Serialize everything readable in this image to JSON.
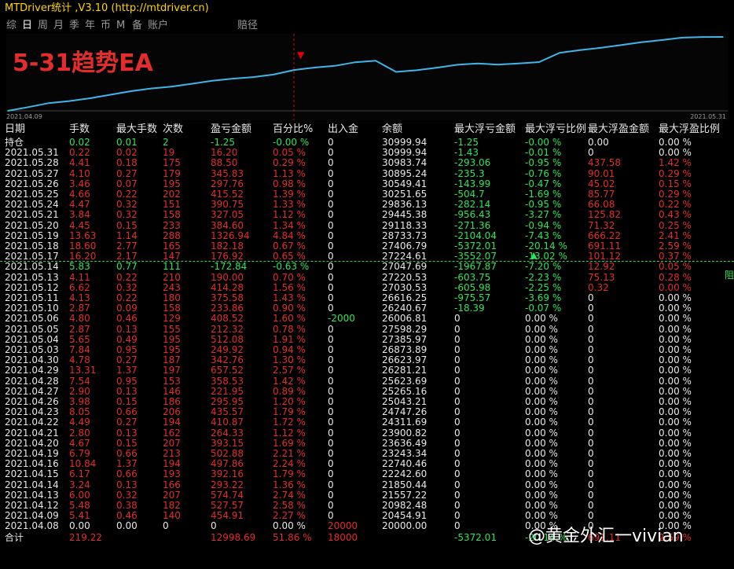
{
  "app": {
    "title": "MTDriver统计 ,V3.10 (http://mtdriver.cn)"
  },
  "tabs": [
    {
      "label": "综"
    },
    {
      "label": "日"
    },
    {
      "label": "周"
    },
    {
      "label": "月"
    },
    {
      "label": "季"
    },
    {
      "label": "年"
    },
    {
      "label": "币"
    },
    {
      "label": "M"
    },
    {
      "label": "备"
    },
    {
      "label": "账户"
    },
    {
      "label": "赔径"
    }
  ],
  "active_tab": 1,
  "chart": {
    "label": "5-31趋势EA",
    "start_date": "2021.04.09",
    "end_date": "2021.05.31",
    "line_color": "#3fb6e8",
    "chart_data": {
      "type": "line",
      "x": [
        "2021.04.09",
        "2021.04.12",
        "2021.04.13",
        "2021.04.14",
        "2021.04.15",
        "2021.04.16",
        "2021.04.19",
        "2021.04.20",
        "2021.04.21",
        "2021.04.22",
        "2021.04.23",
        "2021.04.26",
        "2021.04.27",
        "2021.04.28",
        "2021.04.29",
        "2021.04.30",
        "2021.05.03",
        "2021.05.04",
        "2021.05.05",
        "2021.05.06",
        "2021.05.10",
        "2021.05.11",
        "2021.05.12",
        "2021.05.13",
        "2021.05.14",
        "2021.05.17",
        "2021.05.18",
        "2021.05.19",
        "2021.05.20",
        "2021.05.21",
        "2021.05.24",
        "2021.05.25",
        "2021.05.26",
        "2021.05.27",
        "2021.05.28",
        "2021.05.31"
      ],
      "y": [
        20454.91,
        20982.48,
        21557.22,
        21850.44,
        22242.6,
        22740.46,
        23243.34,
        23636.49,
        23900.82,
        24311.69,
        24747.26,
        25043.21,
        25265.16,
        25623.69,
        26281.21,
        26623.97,
        26873.89,
        27385.97,
        27598.29,
        26006.81,
        26240.67,
        26616.25,
        27030.53,
        27220.53,
        27047.69,
        27224.61,
        27406.79,
        28733.73,
        29118.33,
        29445.38,
        29836.13,
        30251.65,
        30549.41,
        30895.24,
        30983.74,
        30999.94
      ]
    }
  },
  "headers": [
    "日期",
    "手数",
    "最大手数",
    "次数",
    "盈亏金额",
    "百分比%",
    "出入金",
    "余额",
    "最大浮亏金额",
    "最大浮亏比例",
    "最大浮盈金额",
    "最大浮盈比例"
  ],
  "rows": [
    {
      "d": "持仓",
      "lots": "0.02",
      "maxlots": "0.01",
      "cnt": "2",
      "pl": "-1.25",
      "pct": "-0.00 %",
      "io": "0",
      "bal": "30999.94",
      "fl": "-1.25",
      "flp": "-0.00 %",
      "fp": "0.00",
      "fpp": "0.00 %",
      "c": "green"
    },
    {
      "d": "2021.05.31",
      "lots": "0.22",
      "maxlots": "0.02",
      "cnt": "19",
      "pl": "16.20",
      "pct": "0.05 %",
      "io": "0",
      "bal": "30999.94",
      "fl": "-1.43",
      "flp": "-0.01 %",
      "fp": "0",
      "fpp": "0.00 %",
      "c": "red"
    },
    {
      "d": "2021.05.28",
      "lots": "4.41",
      "maxlots": "0.18",
      "cnt": "175",
      "pl": "88.50",
      "pct": "0.29 %",
      "io": "0",
      "bal": "30983.74",
      "fl": "-293.06",
      "flp": "-0.95 %",
      "fp": "437.58",
      "fpp": "1.42 %",
      "c": "red"
    },
    {
      "d": "2021.05.27",
      "lots": "4.10",
      "maxlots": "0.27",
      "cnt": "179",
      "pl": "345.83",
      "pct": "1.13 %",
      "io": "0",
      "bal": "30895.24",
      "fl": "-235.3",
      "flp": "-0.76 %",
      "fp": "90.01",
      "fpp": "0.29 %",
      "c": "red"
    },
    {
      "d": "2021.05.26",
      "lots": "3.46",
      "maxlots": "0.07",
      "cnt": "195",
      "pl": "297.76",
      "pct": "0.98 %",
      "io": "0",
      "bal": "30549.41",
      "fl": "-143.99",
      "flp": "-0.47 %",
      "fp": "45.02",
      "fpp": "0.15 %",
      "c": "red"
    },
    {
      "d": "2021.05.25",
      "lots": "4.66",
      "maxlots": "0.22",
      "cnt": "202",
      "pl": "415.52",
      "pct": "1.39 %",
      "io": "0",
      "bal": "30251.65",
      "fl": "-504.7",
      "flp": "-1.69 %",
      "fp": "85.77",
      "fpp": "0.29 %",
      "c": "red"
    },
    {
      "d": "2021.05.24",
      "lots": "4.47",
      "maxlots": "0.32",
      "cnt": "151",
      "pl": "390.75",
      "pct": "1.33 %",
      "io": "0",
      "bal": "29836.13",
      "fl": "-282.14",
      "flp": "-0.95 %",
      "fp": "66.08",
      "fpp": "0.22 %",
      "c": "red"
    },
    {
      "d": "2021.05.21",
      "lots": "3.84",
      "maxlots": "0.32",
      "cnt": "158",
      "pl": "327.05",
      "pct": "1.12 %",
      "io": "0",
      "bal": "29445.38",
      "fl": "-956.43",
      "flp": "-3.27 %",
      "fp": "125.82",
      "fpp": "0.43 %",
      "c": "red"
    },
    {
      "d": "2021.05.20",
      "lots": "4.45",
      "maxlots": "0.15",
      "cnt": "233",
      "pl": "384.60",
      "pct": "1.34 %",
      "io": "0",
      "bal": "29118.33",
      "fl": "-271.36",
      "flp": "-0.94 %",
      "fp": "71.32",
      "fpp": "0.25 %",
      "c": "red"
    },
    {
      "d": "2021.05.19",
      "lots": "13.63",
      "maxlots": "1.14",
      "cnt": "288",
      "pl": "1326.94",
      "pct": "4.84 %",
      "io": "0",
      "bal": "28733.73",
      "fl": "-2104.04",
      "flp": "-7.43 %",
      "fp": "666.22",
      "fpp": "2.41 %",
      "c": "red"
    },
    {
      "d": "2021.05.18",
      "lots": "18.60",
      "maxlots": "2.77",
      "cnt": "165",
      "pl": "182.18",
      "pct": "0.67 %",
      "io": "0",
      "bal": "27406.79",
      "fl": "-5372.01",
      "flp": "-20.14 %",
      "fp": "691.11",
      "fpp": "2.59 %",
      "c": "red"
    },
    {
      "d": "2021.05.17",
      "lots": "16.20",
      "maxlots": "2.17",
      "cnt": "147",
      "pl": "176.92",
      "pct": "0.65 %",
      "io": "0",
      "bal": "27224.61",
      "fl": "-3552.07",
      "flp": "-13.02 %",
      "fp": "101.12",
      "fpp": "0.37 %",
      "c": "red"
    },
    {
      "d": "2021.05.14",
      "lots": "5.83",
      "maxlots": "0.77",
      "cnt": "111",
      "pl": "-172.84",
      "pct": "-0.63 %",
      "io": "0",
      "bal": "27047.69",
      "fl": "-1967.87",
      "flp": "-7.20 %",
      "fp": "12.92",
      "fpp": "0.05 %",
      "c": "green"
    },
    {
      "d": "2021.05.13",
      "lots": "4.11",
      "maxlots": "0.22",
      "cnt": "210",
      "pl": "190.00",
      "pct": "0.70 %",
      "io": "0",
      "bal": "27220.53",
      "fl": "-603.75",
      "flp": "-2.23 %",
      "fp": "75.13",
      "fpp": "0.28 %",
      "c": "red"
    },
    {
      "d": "2021.05.12",
      "lots": "6.62",
      "maxlots": "0.32",
      "cnt": "243",
      "pl": "414.28",
      "pct": "1.56 %",
      "io": "0",
      "bal": "27030.53",
      "fl": "-605.98",
      "flp": "-2.25 %",
      "fp": "0.32",
      "fpp": "0.00 %",
      "c": "red"
    },
    {
      "d": "2021.05.11",
      "lots": "4.13",
      "maxlots": "0.22",
      "cnt": "180",
      "pl": "375.58",
      "pct": "1.43 %",
      "io": "0",
      "bal": "26616.25",
      "fl": "-975.57",
      "flp": "-3.69 %",
      "fp": "0",
      "fpp": "0.00 %",
      "c": "red"
    },
    {
      "d": "2021.05.10",
      "lots": "2.87",
      "maxlots": "0.09",
      "cnt": "158",
      "pl": "233.86",
      "pct": "0.90 %",
      "io": "0",
      "bal": "26240.67",
      "fl": "-18.39",
      "flp": "-0.07 %",
      "fp": "0",
      "fpp": "0.00 %",
      "c": "red"
    },
    {
      "d": "2021.05.06",
      "lots": "4.80",
      "maxlots": "0.46",
      "cnt": "129",
      "pl": "408.52",
      "pct": "1.60 %",
      "io": "-2000",
      "bal": "26006.81",
      "fl": "0",
      "flp": "0.00 %",
      "fp": "0",
      "fpp": "0.00 %",
      "c": "red"
    },
    {
      "d": "2021.05.05",
      "lots": "2.87",
      "maxlots": "0.13",
      "cnt": "155",
      "pl": "212.32",
      "pct": "0.78 %",
      "io": "0",
      "bal": "27598.29",
      "fl": "0",
      "flp": "0.00 %",
      "fp": "0",
      "fpp": "0.00 %",
      "c": "red"
    },
    {
      "d": "2021.05.04",
      "lots": "5.65",
      "maxlots": "0.49",
      "cnt": "195",
      "pl": "512.08",
      "pct": "1.91 %",
      "io": "0",
      "bal": "27385.97",
      "fl": "0",
      "flp": "0.00 %",
      "fp": "0",
      "fpp": "0.00 %",
      "c": "red"
    },
    {
      "d": "2021.05.03",
      "lots": "7.84",
      "maxlots": "0.95",
      "cnt": "195",
      "pl": "249.92",
      "pct": "0.94 %",
      "io": "0",
      "bal": "26873.89",
      "fl": "0",
      "flp": "0.00 %",
      "fp": "0",
      "fpp": "0.00 %",
      "c": "red"
    },
    {
      "d": "2021.04.30",
      "lots": "4.78",
      "maxlots": "0.27",
      "cnt": "187",
      "pl": "342.76",
      "pct": "1.30 %",
      "io": "0",
      "bal": "26623.97",
      "fl": "0",
      "flp": "0.00 %",
      "fp": "0",
      "fpp": "0.00 %",
      "c": "red"
    },
    {
      "d": "2021.04.29",
      "lots": "13.31",
      "maxlots": "1.37",
      "cnt": "197",
      "pl": "657.52",
      "pct": "2.57 %",
      "io": "0",
      "bal": "26281.21",
      "fl": "0",
      "flp": "0.00 %",
      "fp": "0",
      "fpp": "0.00 %",
      "c": "red"
    },
    {
      "d": "2021.04.28",
      "lots": "7.54",
      "maxlots": "0.95",
      "cnt": "153",
      "pl": "358.53",
      "pct": "1.42 %",
      "io": "0",
      "bal": "25623.69",
      "fl": "0",
      "flp": "0.00 %",
      "fp": "0",
      "fpp": "0.00 %",
      "c": "red"
    },
    {
      "d": "2021.04.27",
      "lots": "2.90",
      "maxlots": "0.13",
      "cnt": "146",
      "pl": "221.95",
      "pct": "0.89 %",
      "io": "0",
      "bal": "25265.16",
      "fl": "0",
      "flp": "0.00 %",
      "fp": "0",
      "fpp": "0.00 %",
      "c": "red"
    },
    {
      "d": "2021.04.26",
      "lots": "3.98",
      "maxlots": "0.15",
      "cnt": "186",
      "pl": "295.95",
      "pct": "1.20 %",
      "io": "0",
      "bal": "25043.21",
      "fl": "0",
      "flp": "0.00 %",
      "fp": "0",
      "fpp": "0.00 %",
      "c": "red"
    },
    {
      "d": "2021.04.23",
      "lots": "8.05",
      "maxlots": "0.66",
      "cnt": "206",
      "pl": "435.57",
      "pct": "1.79 %",
      "io": "0",
      "bal": "24747.26",
      "fl": "0",
      "flp": "0.00 %",
      "fp": "0",
      "fpp": "0.00 %",
      "c": "red"
    },
    {
      "d": "2021.04.22",
      "lots": "4.49",
      "maxlots": "0.27",
      "cnt": "194",
      "pl": "410.87",
      "pct": "1.72 %",
      "io": "0",
      "bal": "24311.69",
      "fl": "0",
      "flp": "0.00 %",
      "fp": "0",
      "fpp": "0.00 %",
      "c": "red"
    },
    {
      "d": "2021.04.21",
      "lots": "2.80",
      "maxlots": "0.13",
      "cnt": "162",
      "pl": "264.33",
      "pct": "1.12 %",
      "io": "0",
      "bal": "23900.82",
      "fl": "0",
      "flp": "0.00 %",
      "fp": "0",
      "fpp": "0.00 %",
      "c": "red"
    },
    {
      "d": "2021.04.20",
      "lots": "4.67",
      "maxlots": "0.15",
      "cnt": "207",
      "pl": "393.15",
      "pct": "1.69 %",
      "io": "0",
      "bal": "23636.49",
      "fl": "0",
      "flp": "0.00 %",
      "fp": "0",
      "fpp": "0.00 %",
      "c": "red"
    },
    {
      "d": "2021.04.19",
      "lots": "6.79",
      "maxlots": "0.66",
      "cnt": "213",
      "pl": "502.88",
      "pct": "2.21 %",
      "io": "0",
      "bal": "23243.34",
      "fl": "0",
      "flp": "0.00 %",
      "fp": "0",
      "fpp": "0.00 %",
      "c": "red"
    },
    {
      "d": "2021.04.16",
      "lots": "10.84",
      "maxlots": "1.37",
      "cnt": "194",
      "pl": "497.86",
      "pct": "2.24 %",
      "io": "0",
      "bal": "22740.46",
      "fl": "0",
      "flp": "0.00 %",
      "fp": "0",
      "fpp": "0.00 %",
      "c": "red"
    },
    {
      "d": "2021.04.15",
      "lots": "6.17",
      "maxlots": "0.66",
      "cnt": "193",
      "pl": "392.16",
      "pct": "1.79 %",
      "io": "0",
      "bal": "22242.60",
      "fl": "0",
      "flp": "0.00 %",
      "fp": "0",
      "fpp": "0.00 %",
      "c": "red"
    },
    {
      "d": "2021.04.14",
      "lots": "3.24",
      "maxlots": "0.13",
      "cnt": "166",
      "pl": "293.22",
      "pct": "1.36 %",
      "io": "0",
      "bal": "21850.44",
      "fl": "0",
      "flp": "0.00 %",
      "fp": "0",
      "fpp": "0.00 %",
      "c": "red"
    },
    {
      "d": "2021.04.13",
      "lots": "6.00",
      "maxlots": "0.32",
      "cnt": "207",
      "pl": "574.74",
      "pct": "2.74 %",
      "io": "0",
      "bal": "21557.22",
      "fl": "0",
      "flp": "0.00 %",
      "fp": "0",
      "fpp": "0.00 %",
      "c": "red"
    },
    {
      "d": "2021.04.12",
      "lots": "5.48",
      "maxlots": "0.38",
      "cnt": "182",
      "pl": "527.57",
      "pct": "2.58 %",
      "io": "0",
      "bal": "20982.48",
      "fl": "0",
      "flp": "0.00 %",
      "fp": "0",
      "fpp": "0.00 %",
      "c": "red"
    },
    {
      "d": "2021.04.09",
      "lots": "5.41",
      "maxlots": "0.46",
      "cnt": "140",
      "pl": "454.91",
      "pct": "2.27 %",
      "io": "0",
      "bal": "20454.91",
      "fl": "0",
      "flp": "0.00 %",
      "fp": "0",
      "fpp": "0.00 %",
      "c": "red"
    },
    {
      "d": "2021.04.08",
      "lots": "0.00",
      "maxlots": "0.00",
      "cnt": "0",
      "pl": "0",
      "pct": "0.00 %",
      "io": "20000",
      "bal": "20000.00",
      "fl": "0",
      "flp": "0.00 %",
      "fp": "0",
      "fpp": "0.00 %",
      "c": "white"
    }
  ],
  "total": {
    "d": "合计",
    "lots": "219.22",
    "maxlots": "",
    "cnt": "",
    "pl": "12998.69",
    "pct": "51.86 %",
    "io": "18000",
    "bal": "",
    "fl": "-5372.01",
    "flp": "-20.14 %",
    "fp": "691.11",
    "fpp": "2.59 %"
  },
  "side_label": "阻",
  "watermark": "@黄金外汇一vivian"
}
